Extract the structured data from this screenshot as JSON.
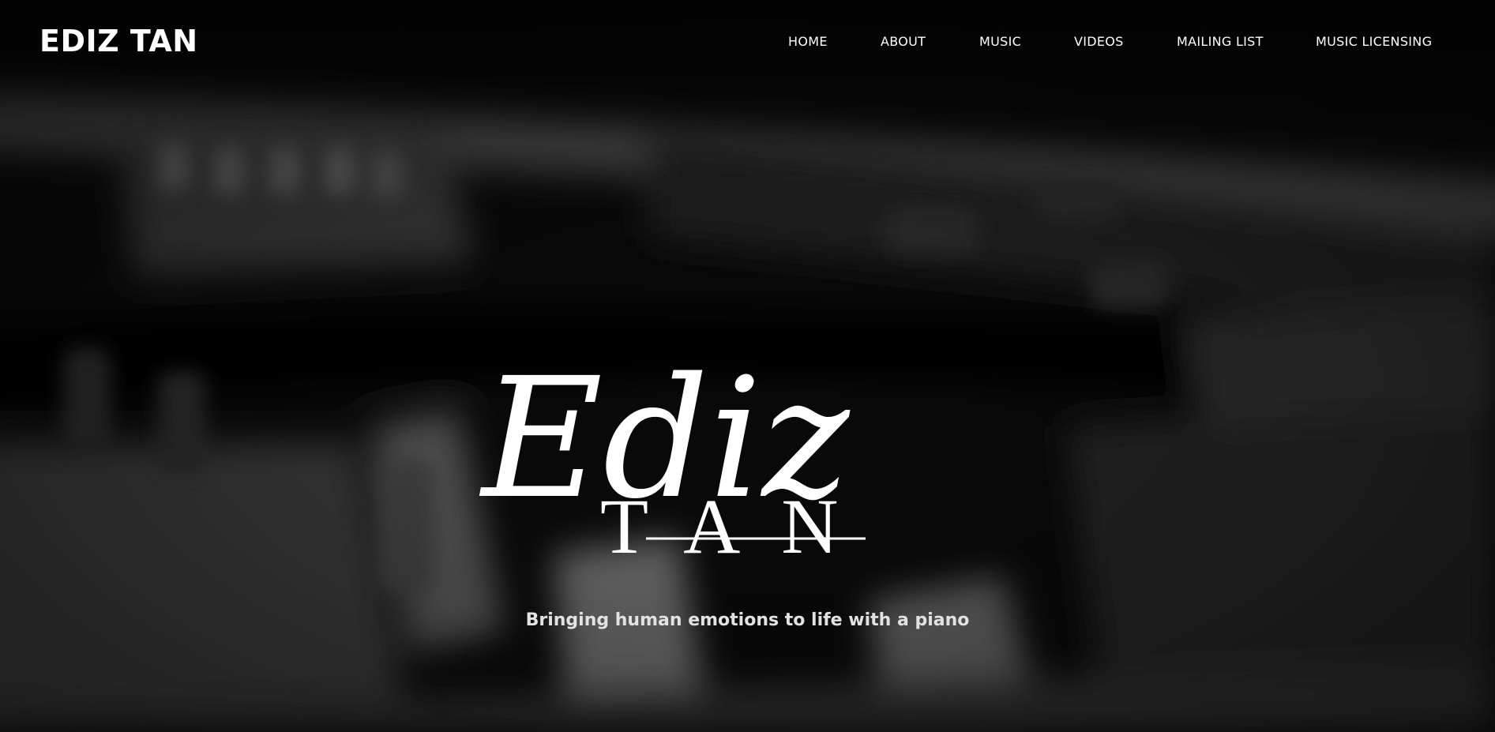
{
  "header": {
    "site_title": "EDIZ TAN",
    "nav": [
      {
        "label": "HOME"
      },
      {
        "label": "ABOUT"
      },
      {
        "label": "MUSIC"
      },
      {
        "label": "VIDEOS"
      },
      {
        "label": "MAILING LIST"
      },
      {
        "label": "MUSIC LICENSING"
      }
    ]
  },
  "hero": {
    "logo_script": "Ediz",
    "logo_caps": "TAN",
    "tagline": "Bringing human emotions to life with a piano",
    "background": "blurred-piano-keys-photo"
  },
  "colors": {
    "background": "#0b0b0b",
    "text": "#ffffff",
    "tagline": "#e2e2e2"
  }
}
